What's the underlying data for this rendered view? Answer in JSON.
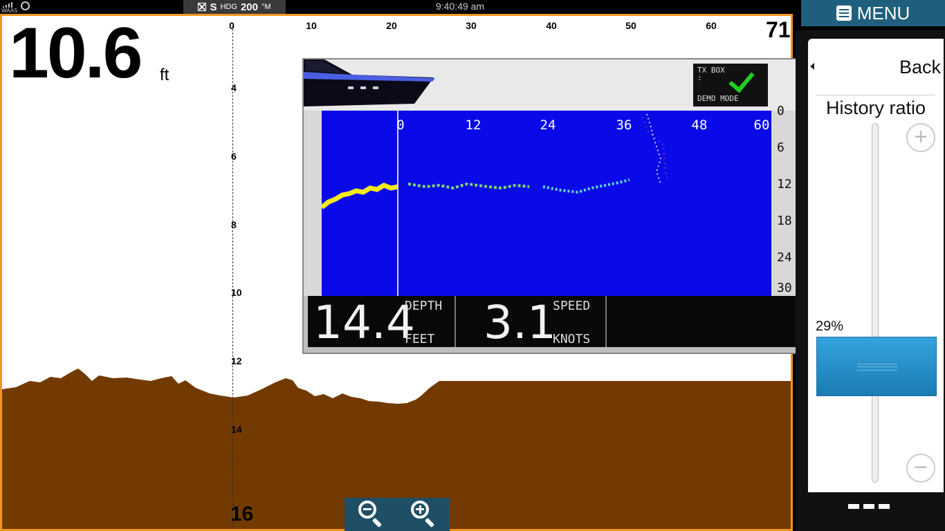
{
  "status_bar": {
    "gps_mode": "WAAS",
    "heading_prefix": "S",
    "heading_label": "HDG",
    "heading_value": "200",
    "heading_unit": "°M",
    "time": "9:40:49 am"
  },
  "sonar": {
    "depth_value": "10.6",
    "depth_unit": "ft",
    "range_corner": "71",
    "x_ticks": [
      "0",
      "10",
      "20",
      "30",
      "40",
      "50",
      "60"
    ],
    "y_ticks": [
      "4",
      "6",
      "8",
      "10",
      "12",
      "14",
      "16"
    ],
    "colors": {
      "border": "#f0961e",
      "bottom": "#733a00",
      "water": "#ffffff"
    }
  },
  "video": {
    "tx_label": "TX BOX :",
    "mode_label": "DEMO MODE",
    "x_ticks": [
      "0",
      "12",
      "24",
      "36",
      "48",
      "60"
    ],
    "y_ticks": [
      "0",
      "6",
      "12",
      "18",
      "24",
      "30"
    ],
    "depth_value": "14.4",
    "depth_label": "DEPTH",
    "depth_unit": "FEET",
    "speed_value": "3.1",
    "speed_label": "SPEED",
    "speed_unit": "KNOTS"
  },
  "side_menu": {
    "menu_label": "MENU",
    "back_label": "Back",
    "history_label": "History ratio",
    "slider_value": "29%",
    "slider_fraction": 0.29,
    "plus_label": "+",
    "minus_label": "−"
  }
}
